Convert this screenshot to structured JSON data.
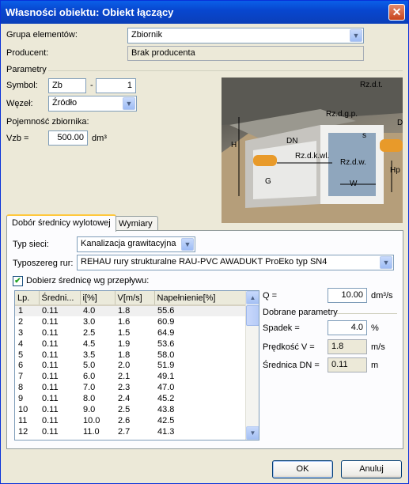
{
  "window": {
    "title": "Własności obiektu: Obiekt łączący",
    "close_glyph": "✕"
  },
  "general": {
    "group_label": "Grupa elementów:",
    "group_value": "Zbiornik",
    "producer_label": "Producent:",
    "producer_value": "Brak producenta"
  },
  "params": {
    "section_label": "Parametry",
    "symbol_label": "Symbol:",
    "symbol_value": "Zb",
    "symbol_sep": "-",
    "symbol_number": "1",
    "node_label": "Węzeł:",
    "node_value": "Źródło",
    "capacity_label": "Pojemność zbiornika:",
    "vzb_label": "Vzb =",
    "vzb_value": "500.00",
    "vzb_unit": "dm³"
  },
  "diagram": {
    "labels": [
      "Rz.d.t.",
      "Rz.d.g.p.",
      "D",
      "s",
      "H",
      "DN",
      "Rz.d.k.wl.",
      "Rz.d.w.",
      "G",
      "W",
      "Hp"
    ]
  },
  "tabs": [
    {
      "label": "Dobór średnicy wylotowej",
      "active": true
    },
    {
      "label": "Wymiary",
      "active": false
    }
  ],
  "outlet": {
    "network_type_label": "Typ sieci:",
    "network_type_value": "Kanalizacja grawitacyjna",
    "pipe_series_label": "Typoszereg rur:",
    "pipe_series_value": "REHAU rury strukturalne RAU-PVC AWADUKT ProEko typ SN4",
    "auto_diameter_label": "Dobierz średnicę wg przepływu:",
    "auto_diameter_checked": true
  },
  "table": {
    "columns": [
      "Lp.",
      "Średni...",
      "i[%]",
      "V[m/s]",
      "Napełnienie[%]"
    ],
    "rows": [
      [
        "1",
        "0.11",
        "4.0",
        "1.8",
        "55.6"
      ],
      [
        "2",
        "0.11",
        "3.0",
        "1.6",
        "60.9"
      ],
      [
        "3",
        "0.11",
        "2.5",
        "1.5",
        "64.9"
      ],
      [
        "4",
        "0.11",
        "4.5",
        "1.9",
        "53.6"
      ],
      [
        "5",
        "0.11",
        "3.5",
        "1.8",
        "58.0"
      ],
      [
        "6",
        "0.11",
        "5.0",
        "2.0",
        "51.9"
      ],
      [
        "7",
        "0.11",
        "6.0",
        "2.1",
        "49.1"
      ],
      [
        "8",
        "0.11",
        "7.0",
        "2.3",
        "47.0"
      ],
      [
        "9",
        "0.11",
        "8.0",
        "2.4",
        "45.2"
      ],
      [
        "10",
        "0.11",
        "9.0",
        "2.5",
        "43.8"
      ],
      [
        "11",
        "0.11",
        "10.0",
        "2.6",
        "42.5"
      ],
      [
        "12",
        "0.11",
        "11.0",
        "2.7",
        "41.3"
      ]
    ],
    "scroll_up": "▲",
    "scroll_down": "▼"
  },
  "flow": {
    "q_label": "Q =",
    "q_value": "10.00",
    "q_unit": "dm³/s",
    "chosen_label": "Dobrane parametry",
    "slope_label": "Spadek =",
    "slope_value": "4.0",
    "slope_unit": "%",
    "velocity_label": "Prędkość V =",
    "velocity_value": "1.8",
    "velocity_unit": "m/s",
    "diameter_label": "Średnica DN =",
    "diameter_value": "0.11",
    "diameter_unit": "m"
  },
  "buttons": {
    "ok": "OK",
    "cancel": "Anuluj"
  },
  "icons": {
    "dropdown": "chevron-down-icon",
    "close": "close-icon",
    "check": "check-icon"
  },
  "colors": {
    "titlebar": "#0a5fe8",
    "dialog_bg": "#ece9d8",
    "tab_highlight": "#ffc83c"
  }
}
